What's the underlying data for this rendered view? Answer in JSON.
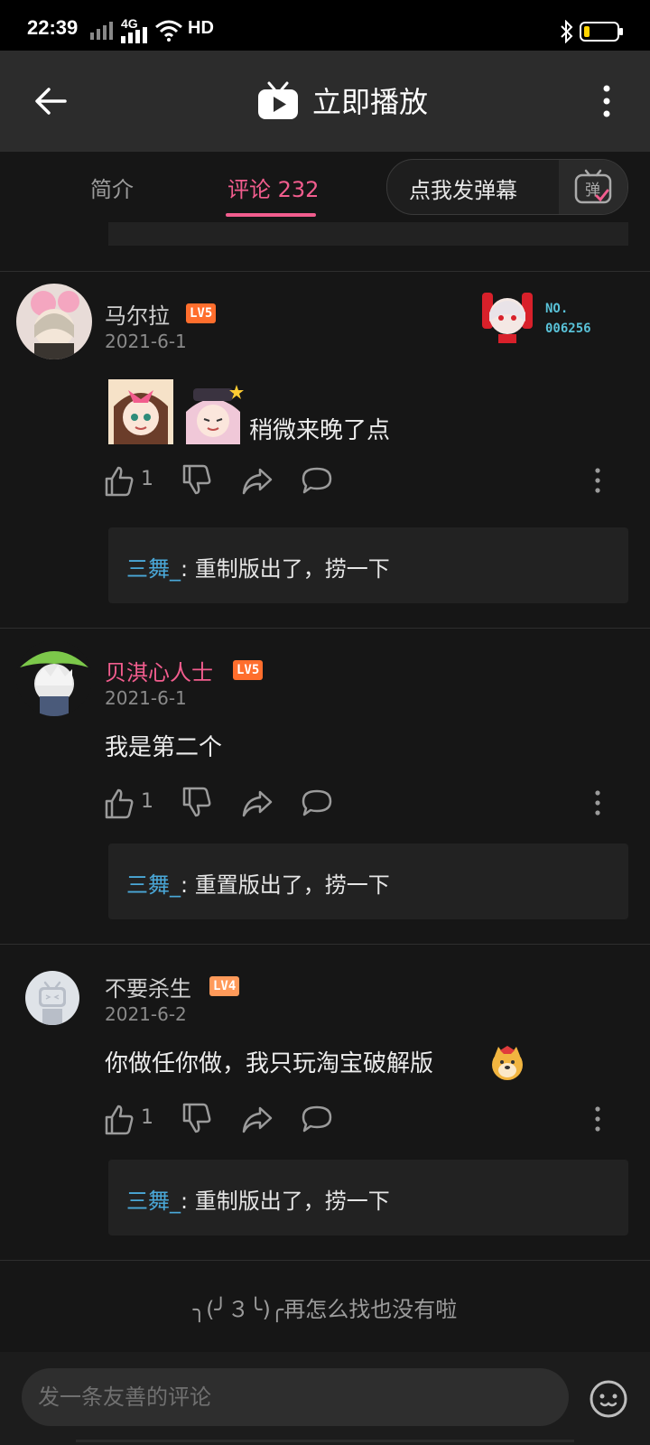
{
  "status_bar": {
    "time": "22:39",
    "network_1": "4G",
    "network_2": "HD"
  },
  "titlebar": {
    "title": "立即播放"
  },
  "tabs": [
    {
      "label": "简介"
    },
    {
      "label": "评论 232"
    }
  ],
  "danmaku_button": {
    "label": "点我发弹幕",
    "icon_glyph": "弹"
  },
  "badge": {
    "label": "NO.",
    "number": "006256"
  },
  "comments": [
    {
      "username": "马尔拉",
      "level": "LV5",
      "date": "2021-6-1",
      "text": "稍微来晚了点",
      "likes": "1",
      "reply_user": "三舞_",
      "reply_text": ": 重制版出了，捞一下"
    },
    {
      "username": "贝淇心人士",
      "level": "LV5",
      "date": "2021-6-1",
      "text": "我是第二个",
      "likes": "1",
      "reply_user": "三舞_",
      "reply_text": ": 重置版出了，捞一下"
    },
    {
      "username": "不要杀生",
      "level": "LV4",
      "date": "2021-6-2",
      "text": "你做任你做，我只玩淘宝破解版",
      "likes": "1",
      "reply_user": "三舞_",
      "reply_text": ": 重制版出了，捞一下"
    }
  ],
  "end_text": "╮(╯３╰)╭再怎么找也没有啦",
  "comment_input": {
    "placeholder": "发一条友善的评论"
  },
  "colors": {
    "accent": "#f25d8e",
    "reply_name": "#4aa8d8",
    "level5": "#ff6e2d"
  }
}
